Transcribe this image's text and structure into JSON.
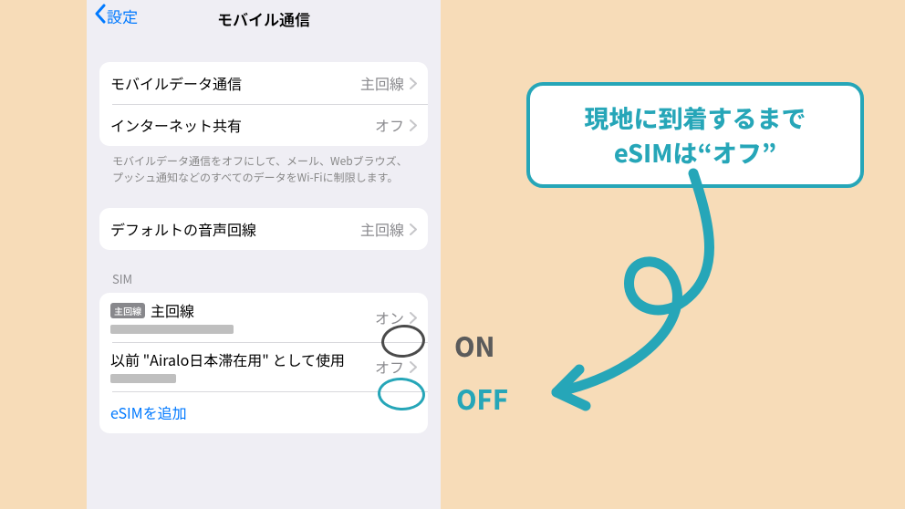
{
  "header": {
    "back_label": "設定",
    "title": "モバイル通信"
  },
  "group1": {
    "row1_label": "モバイルデータ通信",
    "row1_value": "主回線",
    "row2_label": "インターネット共有",
    "row2_value": "オフ",
    "footnote": "モバイルデータ通信をオフにして、メール、Webブラウズ、プッシュ通知などのすべてのデータをWi-Fiに制限します。"
  },
  "group2": {
    "row1_label": "デフォルトの音声回線",
    "row1_value": "主回線"
  },
  "sim": {
    "heading": "SIM",
    "item1_badge": "主回線",
    "item1_name": "主回線",
    "item1_status": "オン",
    "item2_name": "以前 \"Airalo日本滞在用\" として使用",
    "item2_status": "オフ",
    "add_label": "eSIMを追加"
  },
  "annotation": {
    "callout_line1": "現地に到着するまで",
    "callout_line2": "eSIMは“オフ”",
    "on_label": "ON",
    "off_label": "OFF"
  }
}
